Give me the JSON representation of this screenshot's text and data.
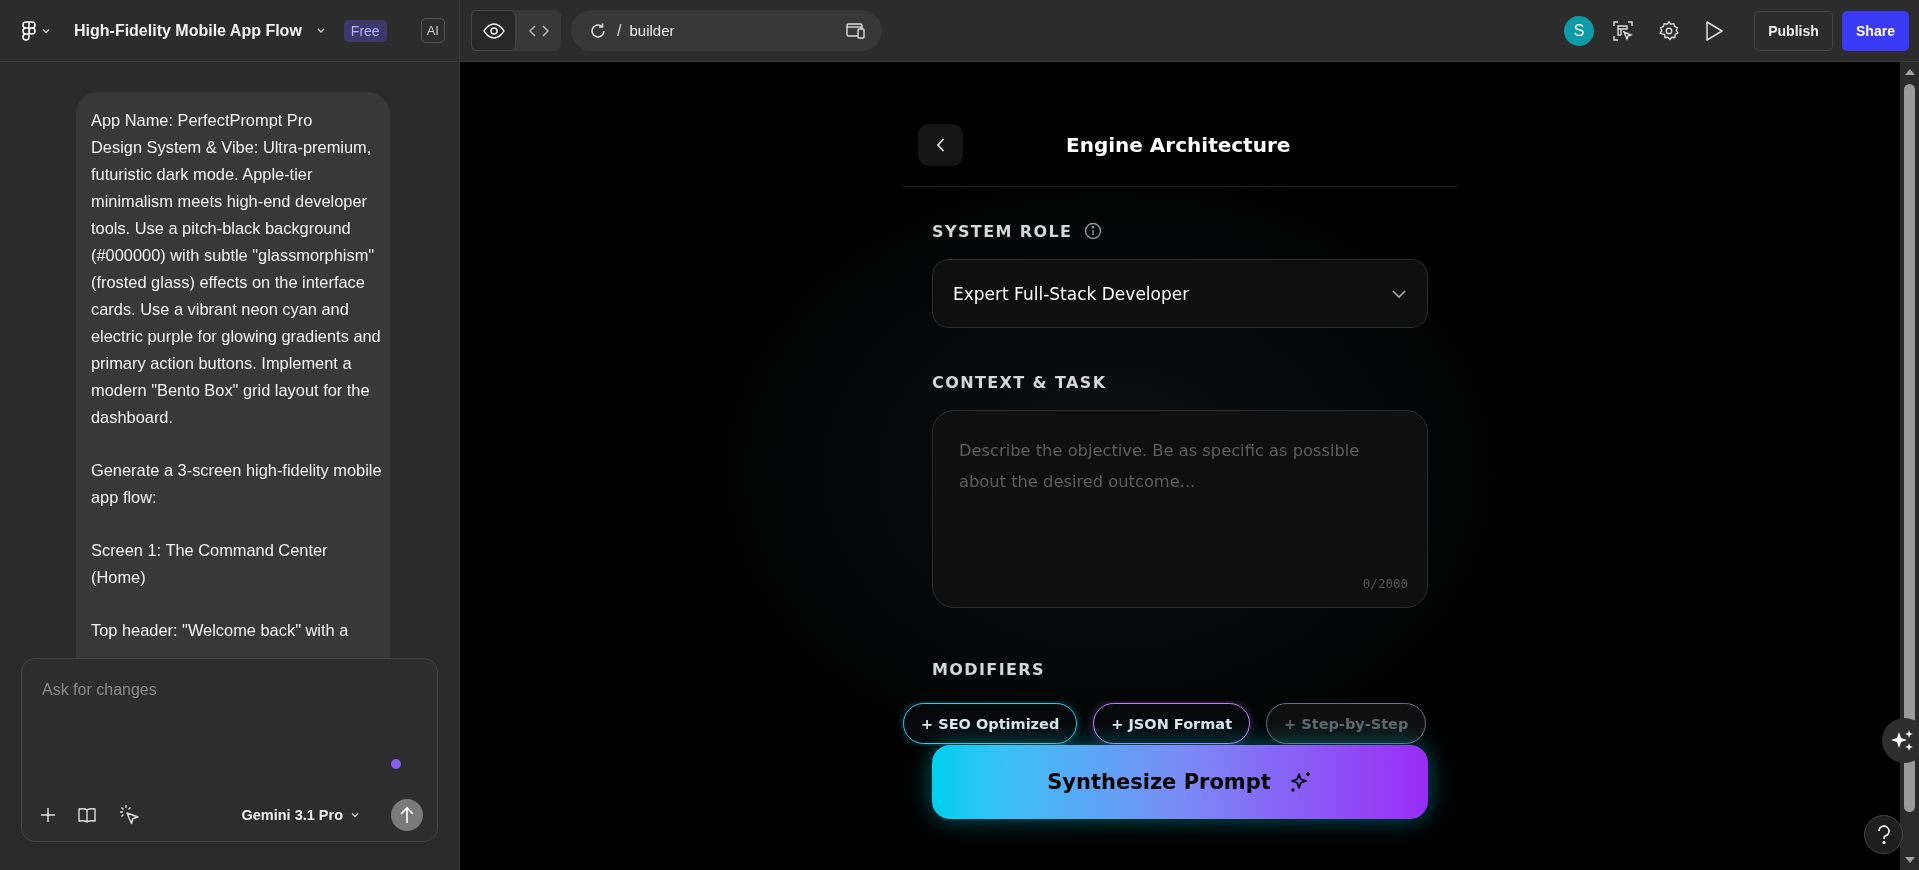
{
  "header": {
    "title": "High-Fidelity Mobile App Flow",
    "plan_badge": "Free",
    "ai_badge": "AI",
    "view_toggle": [
      {
        "kind": "preview",
        "selected": true
      },
      {
        "kind": "code",
        "selected": false
      }
    ],
    "url": {
      "separator": "/",
      "path": "builder"
    },
    "avatar": "S",
    "publish_button": "Publish",
    "share_button": "Share"
  },
  "chat": {
    "message": [
      "App Name: PerfectPrompt Pro\nDesign System & Vibe: Ultra-premium, futuristic dark mode. Apple-tier minimalism meets high-end developer tools. Use a pitch-black background (#000000) with subtle \"glassmorphism\" (frosted glass) effects on the interface cards. Use a vibrant neon cyan and electric purple for glowing gradients and primary action buttons. Implement a modern \"Bento Box\" grid layout for the dashboard.",
      "Generate a 3-screen high-fidelity mobile app flow:",
      "Screen 1: The Command Center (Home)",
      "Top header: \"Welcome back\" with a"
    ],
    "composer": {
      "placeholder": "Ask for changes",
      "model": "Gemini 3.1 Pro"
    }
  },
  "screen": {
    "title": "Engine Architecture",
    "system_role": {
      "label": "SYSTEM ROLE",
      "value": "Expert Full-Stack Developer"
    },
    "context": {
      "label": "CONTEXT & TASK",
      "placeholder": "Describe the objective. Be as specific as possible about the desired outcome...",
      "counter": "0/2000"
    },
    "modifiers": {
      "label": "MODIFIERS",
      "chips": [
        {
          "label": "+ SEO Optimized",
          "selected": true,
          "color": "#22d3ee"
        },
        {
          "label": "+ JSON Format",
          "selected": true,
          "color": "#c084fc"
        },
        {
          "label": "+ Step-by-Step",
          "selected": false,
          "color": "#6b7280"
        }
      ]
    },
    "primary_button": "Synthesize Prompt"
  }
}
